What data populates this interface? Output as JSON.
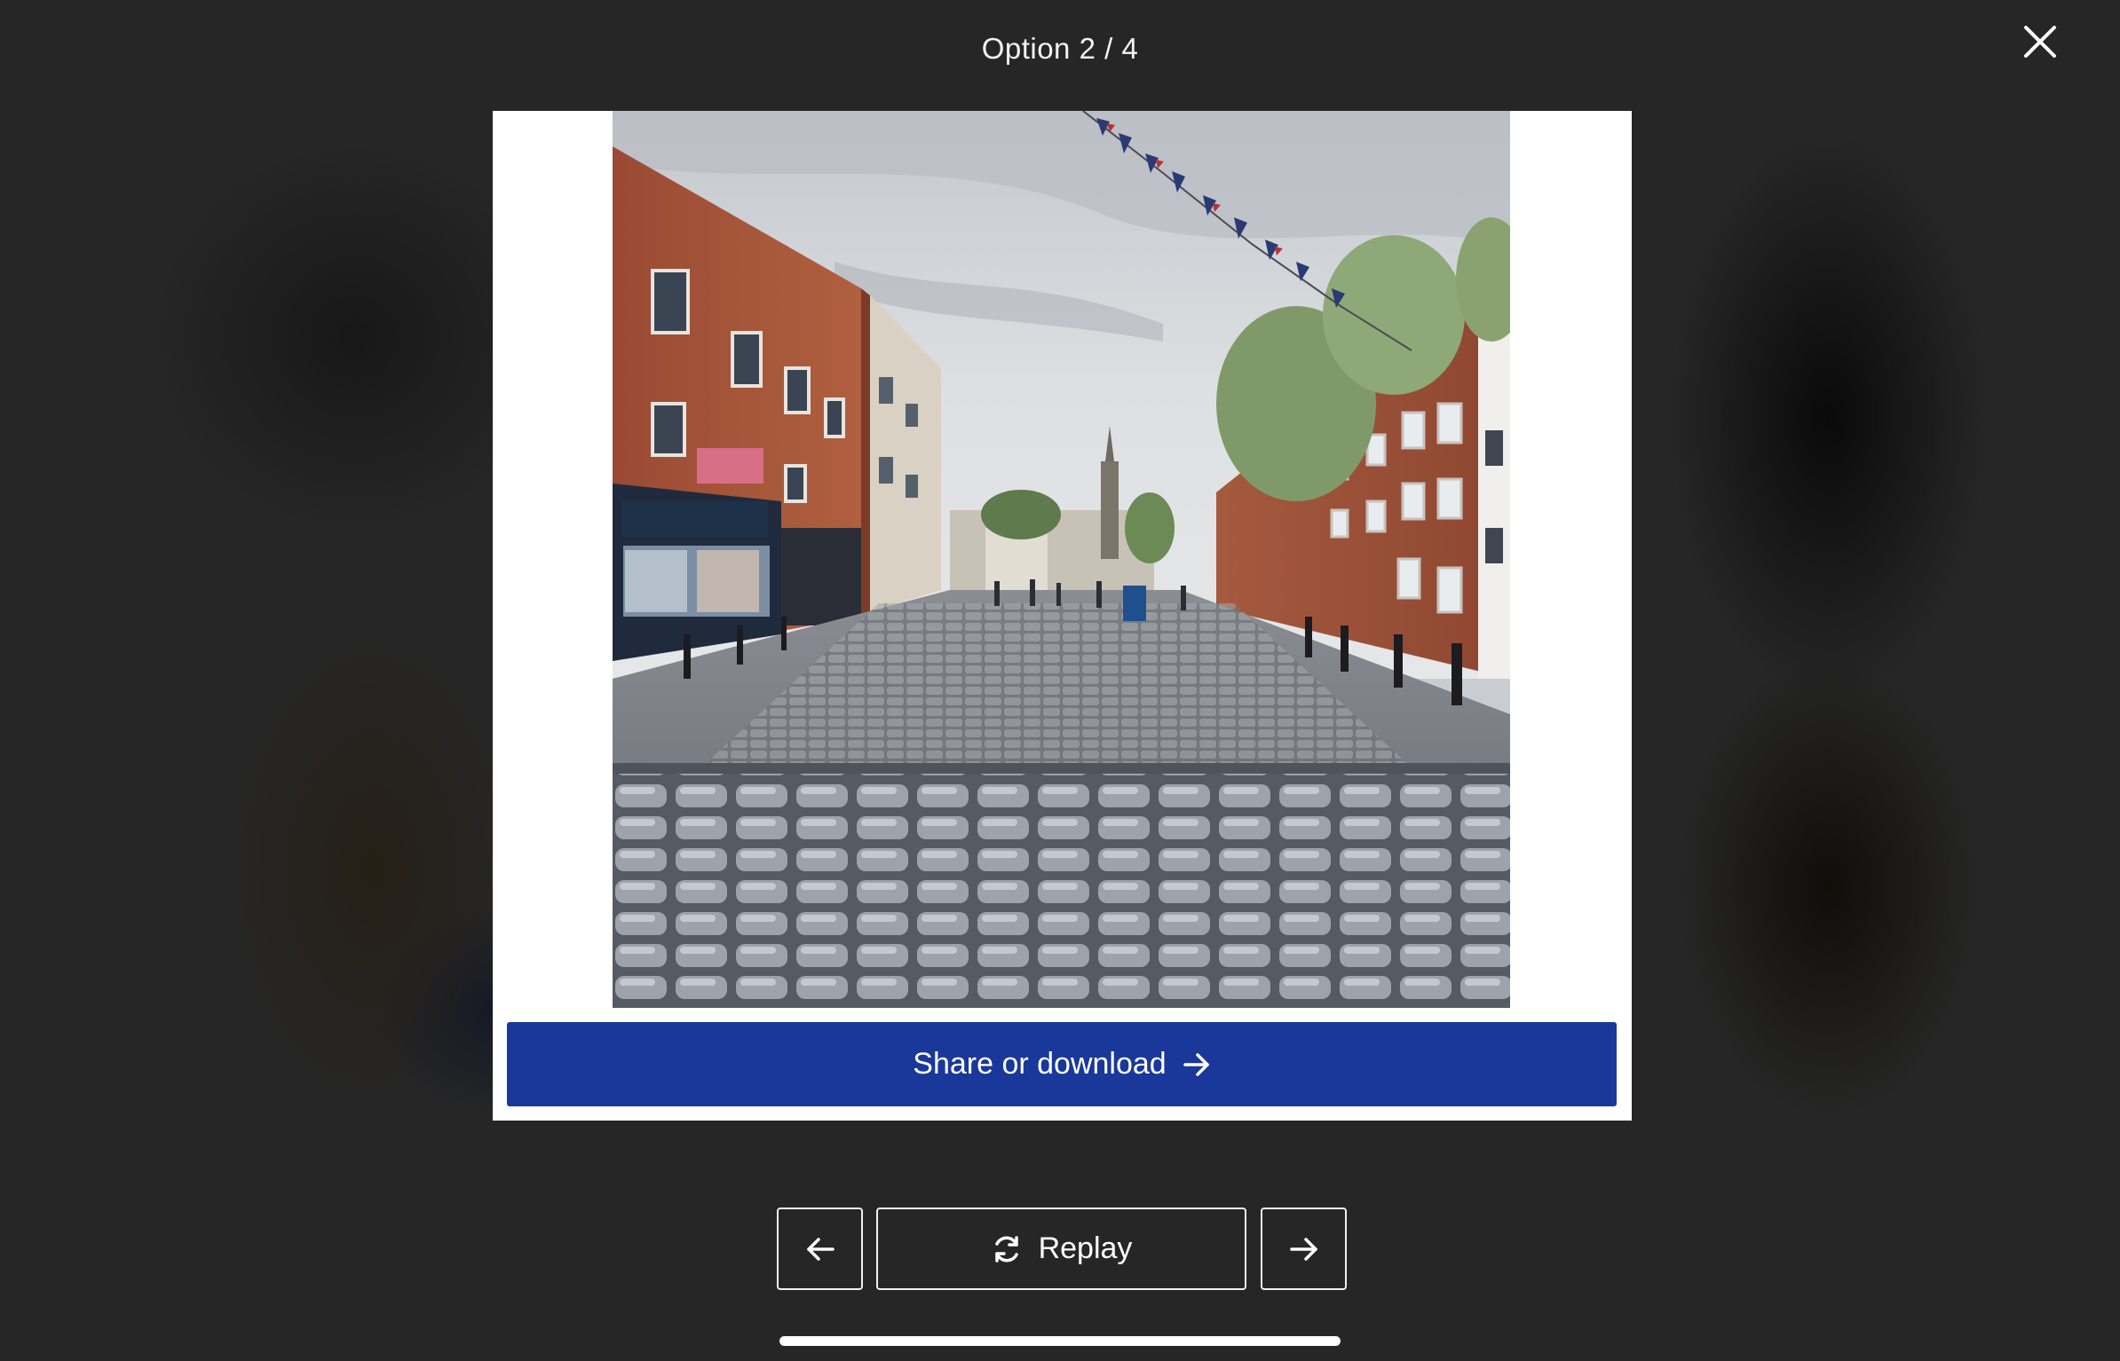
{
  "header": {
    "title": "Option 2 / 4"
  },
  "card": {
    "share_label": "Share or download"
  },
  "controls": {
    "replay_label": "Replay"
  },
  "icons": {
    "close": "close-icon",
    "share_arrow": "arrow-right-icon",
    "prev": "arrow-left-icon",
    "replay": "refresh-icon",
    "next": "arrow-right-icon"
  },
  "colors": {
    "background": "#252525",
    "share_button": "#1a3899",
    "text": "#ffffff"
  },
  "progress": 1.0
}
